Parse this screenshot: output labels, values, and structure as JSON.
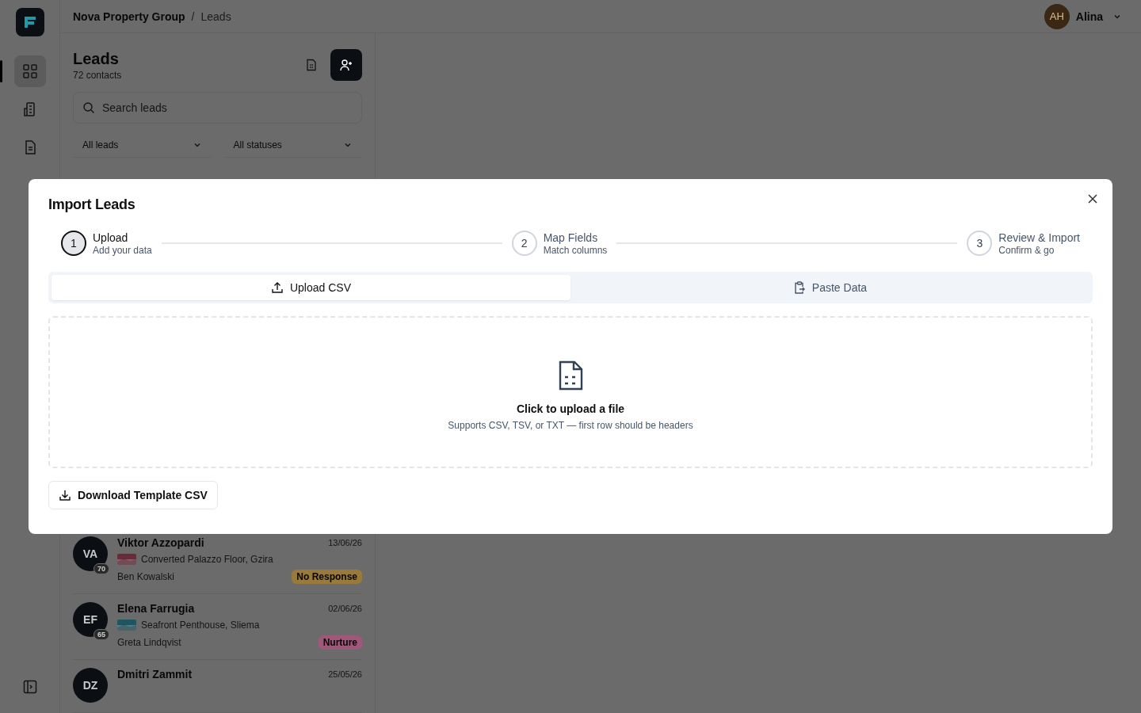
{
  "breadcrumb": {
    "organization": "Nova Property Group",
    "separator": "/",
    "page": "Leads"
  },
  "user": {
    "initials": "AH",
    "name": "Alina"
  },
  "sidebar": {
    "items": [
      {
        "selected": true
      },
      {
        "selected": false
      },
      {
        "selected": false
      }
    ]
  },
  "leads_panel": {
    "title": "Leads",
    "count": "72 contacts",
    "search": {
      "placeholder": "Search leads"
    },
    "filters": [
      "All leads",
      "All statuses"
    ],
    "rows": [
      {
        "initials": "VA",
        "score": "70",
        "name": "Viktor Azzopardi",
        "date": "13/06/26",
        "property": "Converted Palazzo Floor, Gzira",
        "agent": "Ben Kowalski",
        "status": "No Response",
        "color": "#9a7a3a"
      },
      {
        "initials": "EF",
        "score": "65",
        "name": "Elena Farrugia",
        "date": "02/06/26",
        "property": "Seafront Penthouse, Sliema",
        "agent": "Greta Lindqvist",
        "status": "Nurture",
        "color": "#a0587a"
      },
      {
        "initials": "DZ",
        "name": "Dmitri Zammit",
        "date": "25/05/26"
      }
    ]
  },
  "modal": {
    "title": "Import Leads",
    "steps": [
      {
        "number": "1",
        "title": "Upload",
        "subtitle": "Add your data",
        "selected": true
      },
      {
        "number": "2",
        "title": "Map Fields",
        "subtitle": "Match columns",
        "selected": false
      },
      {
        "number": "3",
        "title": "Review & Import",
        "subtitle": "Confirm & go",
        "selected": false
      }
    ],
    "tabs": [
      {
        "label": "Upload CSV",
        "selected": true
      },
      {
        "label": "Paste Data",
        "selected": false
      }
    ],
    "dropzone": {
      "title": "Click to upload a file",
      "hint": "Supports CSV, TSV, or TXT — first row should be headers"
    },
    "download_button": "Download Template CSV"
  }
}
